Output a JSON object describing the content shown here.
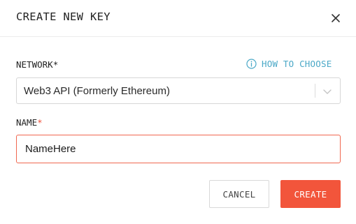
{
  "dialog": {
    "title": "CREATE NEW KEY"
  },
  "network": {
    "label": "NETWORK",
    "required_marker": "*",
    "how_to_choose": "HOW TO CHOOSE",
    "selected_value": "Web3 API (Formerly Ethereum)"
  },
  "name": {
    "label": "NAME",
    "required_marker": "*",
    "value": "NameHere"
  },
  "actions": {
    "cancel_label": "CANCEL",
    "create_label": "CREATE"
  },
  "colors": {
    "accent": "#f2553b",
    "link": "#4aa8c7",
    "input_focus_border": "#f0674f",
    "required_marker": "#f0513a"
  },
  "icons": {
    "close": "close-icon",
    "info": "info-icon",
    "dropdown": "chevron-down-icon"
  }
}
